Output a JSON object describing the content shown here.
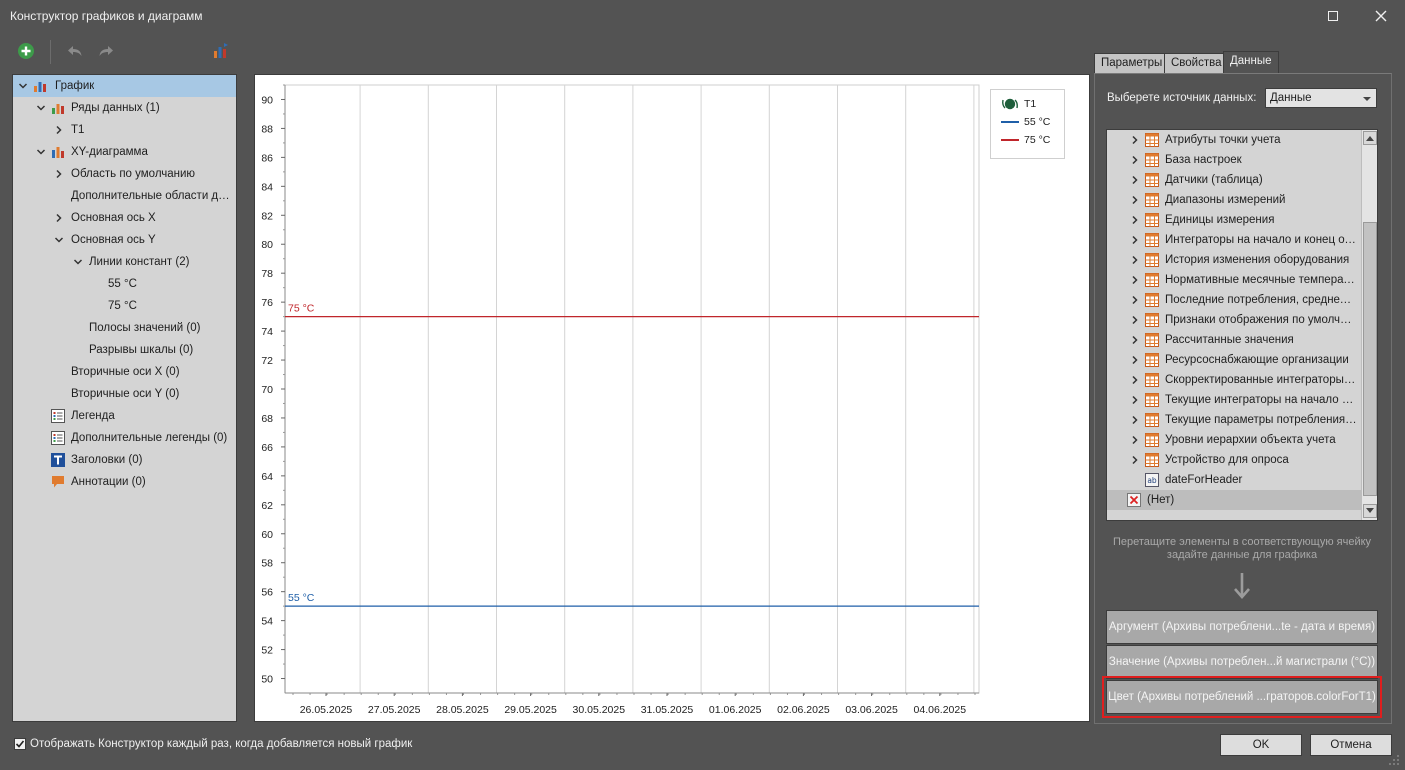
{
  "window": {
    "title": "Конструктор графиков и диаграмм"
  },
  "toolbar": {
    "add_icon": "add-circle-icon",
    "undo_icon": "undo-icon",
    "redo_icon": "redo-icon",
    "chart_wizard_icon": "chart-wizard-icon"
  },
  "tree": {
    "items": [
      {
        "label": "График",
        "icon": "chart-icon"
      },
      {
        "label": "Ряды данных (1)",
        "icon": "chart-icon"
      },
      {
        "label": "T1",
        "icon": ""
      },
      {
        "label": "XY-диаграмма",
        "icon": "chart-icon"
      },
      {
        "label": "Область по умолчанию",
        "icon": ""
      },
      {
        "label": "Дополнительные области ди...",
        "icon": ""
      },
      {
        "label": "Основная ось X",
        "icon": ""
      },
      {
        "label": "Основная ось Y",
        "icon": ""
      },
      {
        "label": "Линии констант (2)",
        "icon": ""
      },
      {
        "label": "55 °C",
        "icon": ""
      },
      {
        "label": "75 °C",
        "icon": ""
      },
      {
        "label": "Полосы значений (0)",
        "icon": ""
      },
      {
        "label": "Разрывы шкалы (0)",
        "icon": ""
      },
      {
        "label": "Вторичные оси X (0)",
        "icon": ""
      },
      {
        "label": "Вторичные оси Y (0)",
        "icon": ""
      },
      {
        "label": "Легенда",
        "icon": "legend-icon"
      },
      {
        "label": "Дополнительные легенды (0)",
        "icon": "legend-icon"
      },
      {
        "label": "Заголовки (0)",
        "icon": "title-icon"
      },
      {
        "label": "Аннотации (0)",
        "icon": "annotation-icon"
      }
    ]
  },
  "chart_data": {
    "type": "line",
    "title": "",
    "xlabel": "",
    "ylabel": "",
    "categories": [
      "26.05.2025",
      "27.05.2025",
      "28.05.2025",
      "29.05.2025",
      "30.05.2025",
      "31.05.2025",
      "01.06.2025",
      "02.06.2025",
      "03.06.2025",
      "04.06.2025"
    ],
    "ylim": [
      49,
      91
    ],
    "y_ticks": [
      50,
      52,
      54,
      56,
      58,
      60,
      62,
      64,
      66,
      68,
      70,
      72,
      74,
      76,
      78,
      80,
      82,
      84,
      86,
      88,
      90
    ],
    "series": [
      {
        "name": "T1",
        "values": []
      }
    ],
    "constant_lines": [
      {
        "name": "55 °C",
        "value": 55,
        "color": "#1f5fa8"
      },
      {
        "name": "75 °C",
        "value": 75,
        "color": "#c0262b"
      }
    ],
    "grid": true,
    "legend": {
      "placement": "top-right",
      "entries": [
        "T1",
        "55 °C",
        "75 °C"
      ]
    }
  },
  "right": {
    "tabs": [
      "Параметры",
      "Свойства",
      "Данные"
    ],
    "active_tab": "Данные",
    "source_label": "Выберете источник данных:",
    "source_value": "Данные",
    "datasources": [
      {
        "label": "Атрибуты точки учета",
        "icon": "table-icon"
      },
      {
        "label": "База настроек",
        "icon": "table-icon"
      },
      {
        "label": "Датчики (таблица)",
        "icon": "table-icon"
      },
      {
        "label": "Диапазоны измерений",
        "icon": "table-icon"
      },
      {
        "label": "Единицы измерения",
        "icon": "table-icon"
      },
      {
        "label": "Интеграторы на начало и конец от...",
        "icon": "table-icon"
      },
      {
        "label": "История изменения оборудования",
        "icon": "table-icon"
      },
      {
        "label": "Нормативные месячные температур...",
        "icon": "table-icon"
      },
      {
        "label": "Последние потребления, среднечас...",
        "icon": "table-icon"
      },
      {
        "label": "Признаки отображения по умолчан...",
        "icon": "table-icon"
      },
      {
        "label": "Рассчитанные значения",
        "icon": "table-icon"
      },
      {
        "label": "Ресурсоснабжающие организации",
        "icon": "table-icon"
      },
      {
        "label": "Скорректированные интеграторы н...",
        "icon": "table-icon"
      },
      {
        "label": "Текущие интеграторы на начало и ...",
        "icon": "table-icon"
      },
      {
        "label": "Текущие параметры потребления, ...",
        "icon": "table-icon"
      },
      {
        "label": "Уровни иерархии объекта учета",
        "icon": "table-icon"
      },
      {
        "label": "Устройство для опроса",
        "icon": "table-icon"
      },
      {
        "label": "dateForHeader",
        "icon": "text-field-icon"
      },
      {
        "label": "(Нет)",
        "icon": "none-icon"
      }
    ],
    "hint": "Перетащите элементы в соответствующую ячейку задайте данные для графика",
    "zones": {
      "argument": "Аргумент (Архивы потреблени...te - дата и время)",
      "value": "Значение (Архивы потреблен...й магистрали (°C))",
      "color": "Цвет (Архивы потреблений ...граторов.colorForT1)"
    }
  },
  "footer": {
    "checkbox_label": "Отображать Конструктор каждый раз, когда добавляется новый график",
    "checkbox_checked": true,
    "ok_label": "OK",
    "cancel_label": "Отмена"
  },
  "colors": {
    "background": "#535353",
    "accent_selection": "#a7c8e4",
    "line_55": "#1f5fa8",
    "line_75": "#c0262b",
    "highlight": "#e01e1e"
  }
}
